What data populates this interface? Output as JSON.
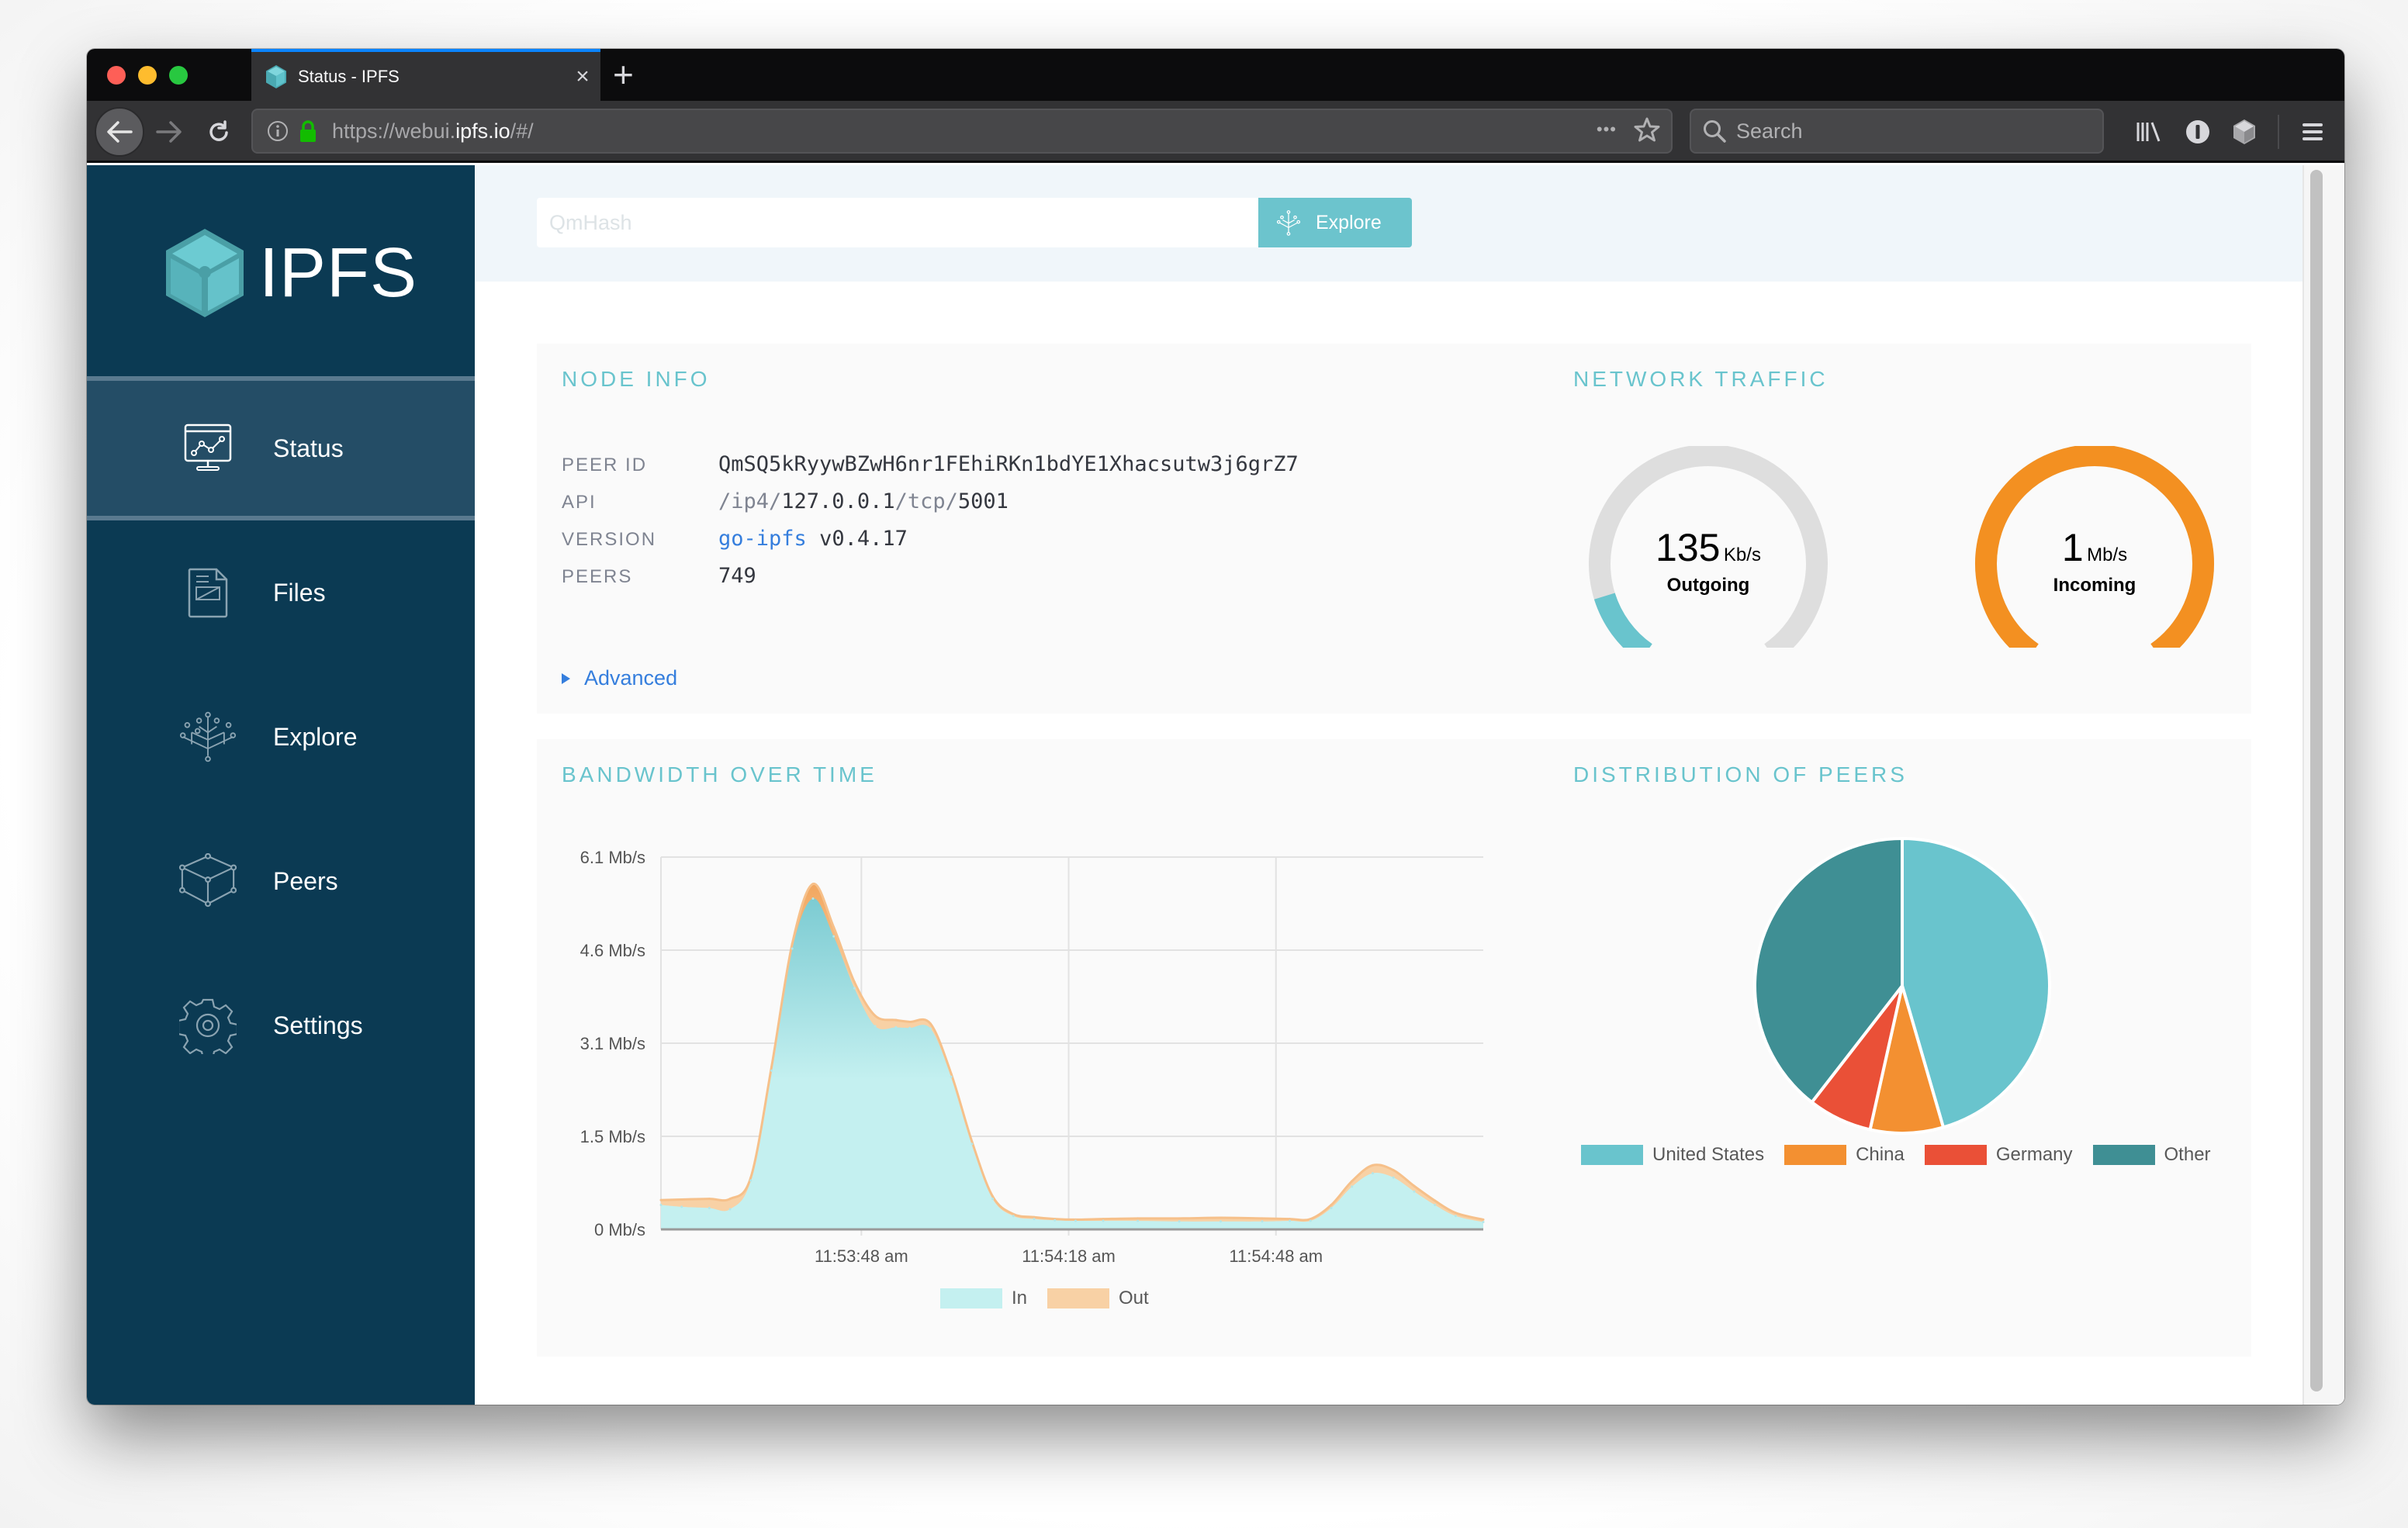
{
  "browser": {
    "tab_title": "Status - IPFS",
    "tab_close": "×",
    "new_tab": "+",
    "url_prefix": "https://webui.",
    "url_domain": "ipfs.io",
    "url_suffix": "/#/",
    "page_actions": "•••",
    "search_placeholder": "Search",
    "icons": [
      "back-arrow",
      "forward-arrow",
      "reload",
      "info",
      "lock",
      "more",
      "star",
      "search",
      "library",
      "1password",
      "ipfs-companion",
      "hamburger-menu"
    ]
  },
  "sidebar": {
    "logo_text": "IPFS",
    "items": [
      {
        "label": "Status",
        "icon": "monitor-chart-icon",
        "active": true
      },
      {
        "label": "Files",
        "icon": "file-icon",
        "active": false
      },
      {
        "label": "Explore",
        "icon": "tree-icon",
        "active": false
      },
      {
        "label": "Peers",
        "icon": "cube-nodes-icon",
        "active": false
      },
      {
        "label": "Settings",
        "icon": "gear-icon",
        "active": false
      }
    ]
  },
  "header": {
    "search_placeholder": "QmHash",
    "search_value": "",
    "explore_label": "Explore"
  },
  "node_info": {
    "title": "NODE INFO",
    "rows": [
      {
        "key": "PEER ID",
        "value": "QmSQ5kRyywBZwH6nr1FEhiRKn1bdYE1Xhacsutw3j6grZ7"
      },
      {
        "key": "API",
        "value_parts": [
          "/ip4/",
          "127.0.0.1",
          "/tcp/",
          "5001"
        ]
      },
      {
        "key": "VERSION",
        "link": "go-ipfs",
        "value": "v0.4.17"
      },
      {
        "key": "PEERS",
        "value": "749"
      }
    ],
    "advanced_label": "Advanced"
  },
  "network_traffic": {
    "title": "NETWORK TRAFFIC",
    "gauges": [
      {
        "value": "135",
        "unit": "Kb/s",
        "label": "Outgoing",
        "fill_fraction": 0.13,
        "color": "#69c4cd"
      },
      {
        "value": "1",
        "unit": "Mb/s",
        "label": "Incoming",
        "fill_fraction": 1.0,
        "color": "#f39021"
      }
    ],
    "track_color": "#dedede"
  },
  "chart_data": [
    {
      "type": "area",
      "title": "BANDWIDTH OVER TIME",
      "xlabel": "",
      "ylabel": "",
      "stacked": true,
      "x_unit": "seconds",
      "x_range": [
        -29,
        90
      ],
      "x_ticks": [
        {
          "t": 0,
          "label": "11:53:48 am"
        },
        {
          "t": 30,
          "label": "11:54:18 am"
        },
        {
          "t": 60,
          "label": "11:54:48 am"
        }
      ],
      "ylim": [
        0,
        6.1
      ],
      "y_ticks": [
        {
          "v": 0,
          "label": "0 Mb/s"
        },
        {
          "v": 1.525,
          "label": "1.5 Mb/s"
        },
        {
          "v": 3.05,
          "label": "3.1 Mb/s"
        },
        {
          "v": 4.575,
          "label": "4.6 Mb/s"
        },
        {
          "v": 6.1,
          "label": "6.1 Mb/s"
        }
      ],
      "grid": true,
      "legend_position": "bottom",
      "x": [
        -29,
        -26,
        -22,
        -19,
        -16,
        -13,
        -10,
        -7,
        -4,
        -1,
        2,
        5,
        7,
        10,
        13,
        16,
        19,
        22,
        25,
        28,
        31,
        35,
        40,
        46,
        52,
        58,
        62,
        65,
        68,
        71,
        74,
        77,
        80,
        83,
        86,
        90
      ],
      "series": [
        {
          "name": "In",
          "color": "#c4f0f0",
          "values": [
            0.4,
            0.37,
            0.35,
            0.33,
            0.8,
            2.6,
            4.6,
            5.42,
            4.8,
            3.95,
            3.33,
            3.31,
            3.3,
            3.29,
            2.5,
            1.4,
            0.5,
            0.22,
            0.17,
            0.15,
            0.14,
            0.14,
            0.14,
            0.13,
            0.13,
            0.13,
            0.14,
            0.14,
            0.35,
            0.7,
            0.92,
            0.85,
            0.62,
            0.4,
            0.22,
            0.12
          ]
        },
        {
          "name": "Out",
          "color": "#f8d1a5",
          "values": [
            0.08,
            0.12,
            0.15,
            0.17,
            0.05,
            0.06,
            0.08,
            0.24,
            0.15,
            0.1,
            0.17,
            0.12,
            0.1,
            0.08,
            0.05,
            0.04,
            0.04,
            0.03,
            0.03,
            0.02,
            0.02,
            0.03,
            0.04,
            0.05,
            0.06,
            0.05,
            0.03,
            0.03,
            0.05,
            0.09,
            0.13,
            0.12,
            0.09,
            0.07,
            0.05,
            0.04
          ]
        }
      ]
    },
    {
      "type": "pie",
      "title": "DISTRIBUTION OF PEERS",
      "legend_position": "bottom",
      "categories": [
        "United States",
        "China",
        "Germany",
        "Other"
      ],
      "values": [
        45.5,
        8.0,
        7.0,
        39.5
      ],
      "colors": [
        "#69c4cd",
        "#f39031",
        "#ea5037",
        "#3f8f94"
      ]
    }
  ]
}
